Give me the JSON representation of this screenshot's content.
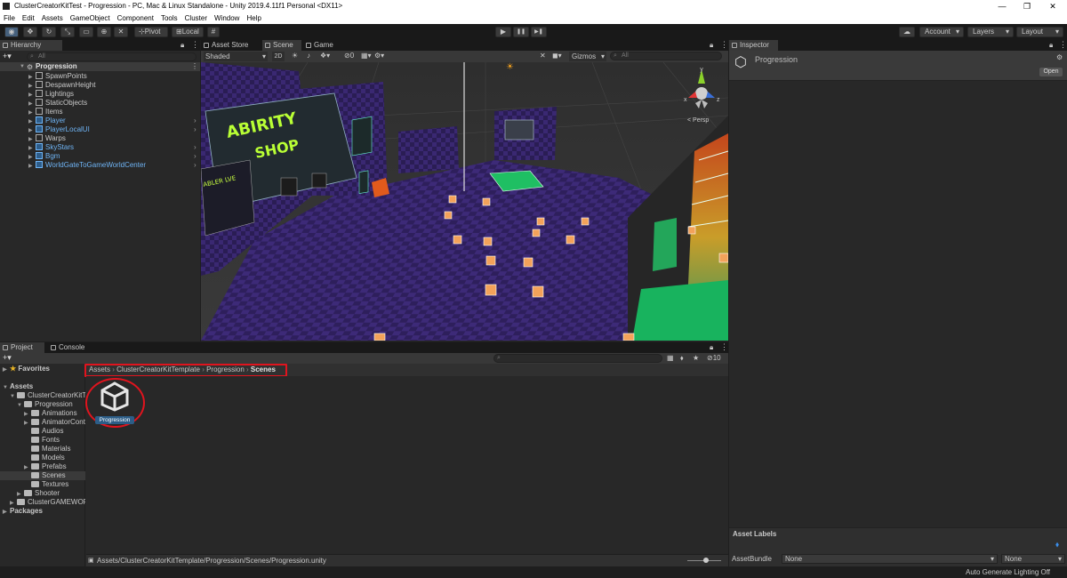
{
  "window": {
    "title": "ClusterCreatorKitTest - Progression - PC, Mac & Linux Standalone - Unity 2019.4.11f1 Personal <DX11>",
    "controls": [
      "—",
      "❐",
      "✕"
    ]
  },
  "menu": [
    "File",
    "Edit",
    "Assets",
    "GameObject",
    "Component",
    "Tools",
    "Cluster",
    "Window",
    "Help"
  ],
  "toolbar": {
    "pivot": "Pivot",
    "local": "Local",
    "play": "▶",
    "pause": "❚❚",
    "step": "▶❚",
    "account": "Account",
    "layers": "Layers",
    "layout": "Layout"
  },
  "hierarchy": {
    "tab": "Hierarchy",
    "add": "+▾",
    "search_placeholder": "All",
    "scene_name": "Progression",
    "items": [
      {
        "label": "SpawnPoints",
        "blue": false
      },
      {
        "label": "DespawnHeight",
        "blue": false
      },
      {
        "label": "Lightings",
        "blue": false
      },
      {
        "label": "StaticObjects",
        "blue": false
      },
      {
        "label": "Items",
        "blue": false
      },
      {
        "label": "Player",
        "blue": true
      },
      {
        "label": "PlayerLocalUI",
        "blue": true
      },
      {
        "label": "Warps",
        "blue": false
      },
      {
        "label": "SkyStars",
        "blue": true
      },
      {
        "label": "Bgm",
        "blue": true
      },
      {
        "label": "WorldGateToGameWorldCenter",
        "blue": true
      }
    ]
  },
  "scene_tabs": [
    {
      "label": "Asset Store"
    },
    {
      "label": "Scene"
    },
    {
      "label": "Game"
    }
  ],
  "scene_toolbar": {
    "shading": "Shaded",
    "mode_2d": "2D",
    "fx_count": "0",
    "gizmos": "Gizmos",
    "search_placeholder": "All"
  },
  "scene": {
    "persp": "< Persp",
    "axis_x": "x",
    "axis_y": "y",
    "axis_z": "z",
    "sign_line1": "ABIRITY",
    "sign_line2": "SHOP",
    "small_sign": "ABLER LVE"
  },
  "inspector": {
    "tab": "Inspector",
    "title": "Progression",
    "open": "Open",
    "asset_labels": "Asset Labels",
    "asset_bundle_label": "AssetBundle",
    "asset_bundle_value": "None",
    "asset_bundle_variant": "None"
  },
  "project": {
    "tabs": [
      "Project",
      "Console"
    ],
    "add": "+▾",
    "favorites": "Favorites",
    "breadcrumb": [
      "Assets",
      "ClusterCreatorKitTemplate",
      "Progression",
      "Scenes"
    ],
    "hidden_count": "10",
    "tree": [
      {
        "label": "Assets",
        "indent": 0,
        "arrow": "▼",
        "bold": true,
        "folder": false
      },
      {
        "label": "ClusterCreatorKitT",
        "indent": 1,
        "arrow": "▼",
        "bold": false,
        "folder": true
      },
      {
        "label": "Progression",
        "indent": 2,
        "arrow": "▼",
        "bold": false,
        "folder": true
      },
      {
        "label": "Animations",
        "indent": 3,
        "arrow": "▶",
        "bold": false,
        "folder": true
      },
      {
        "label": "AnimatorCont",
        "indent": 3,
        "arrow": "▶",
        "bold": false,
        "folder": true
      },
      {
        "label": "Audios",
        "indent": 3,
        "arrow": "",
        "bold": false,
        "folder": true
      },
      {
        "label": "Fonts",
        "indent": 3,
        "arrow": "",
        "bold": false,
        "folder": true
      },
      {
        "label": "Materials",
        "indent": 3,
        "arrow": "",
        "bold": false,
        "folder": true
      },
      {
        "label": "Models",
        "indent": 3,
        "arrow": "",
        "bold": false,
        "folder": true
      },
      {
        "label": "Prefabs",
        "indent": 3,
        "arrow": "▶",
        "bold": false,
        "folder": true
      },
      {
        "label": "Scenes",
        "indent": 3,
        "arrow": "",
        "bold": false,
        "folder": true,
        "selected": true
      },
      {
        "label": "Textures",
        "indent": 3,
        "arrow": "",
        "bold": false,
        "folder": true
      },
      {
        "label": "Shooter",
        "indent": 2,
        "arrow": "▶",
        "bold": false,
        "folder": true
      },
      {
        "label": "ClusterGAMEWORI",
        "indent": 1,
        "arrow": "▶",
        "bold": false,
        "folder": true
      },
      {
        "label": "Packages",
        "indent": 0,
        "arrow": "▶",
        "bold": true,
        "folder": false
      }
    ],
    "asset_name": "Progression",
    "status_path": "Assets/ClusterCreatorKitTemplate/Progression/Scenes/Progression.unity"
  },
  "statusbar": {
    "text": "Auto Generate Lighting Off"
  },
  "colors": {
    "highlight_red": "#e0141e",
    "selection_blue": "#2c5d87",
    "link_blue": "#6fb4f5"
  }
}
